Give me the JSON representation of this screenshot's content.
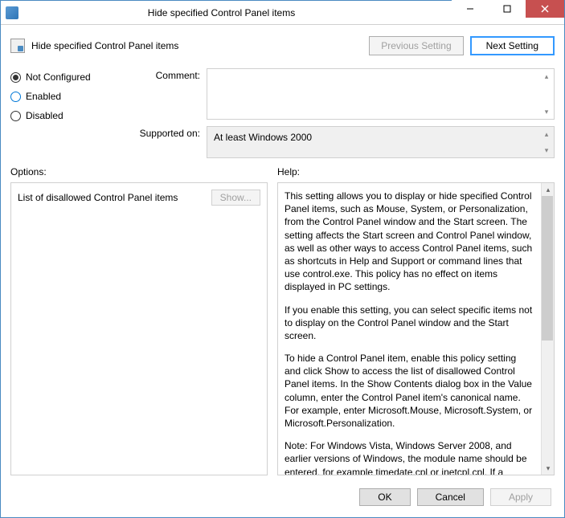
{
  "window": {
    "title": "Hide specified Control Panel items"
  },
  "header": {
    "title": "Hide specified Control Panel items",
    "prev_label": "Previous Setting",
    "next_label": "Next Setting"
  },
  "radios": {
    "not_configured": "Not Configured",
    "enabled": "Enabled",
    "disabled": "Disabled",
    "selected": "not_configured"
  },
  "fields": {
    "comment_label": "Comment:",
    "comment_value": "",
    "supported_label": "Supported on:",
    "supported_value": "At least Windows 2000"
  },
  "panels": {
    "options_label": "Options:",
    "help_label": "Help:"
  },
  "options": {
    "list_label": "List of disallowed Control Panel items",
    "show_label": "Show..."
  },
  "help": {
    "p1": "This setting allows you to display or hide specified Control Panel items, such as Mouse, System, or Personalization, from the Control Panel window and the Start screen. The setting affects the Start screen and Control Panel window, as well as other ways to access Control Panel items, such as shortcuts in Help and Support or command lines that use control.exe. This policy has no effect on items displayed in PC settings.",
    "p2": "If you enable this setting, you can select specific items not to display on the Control Panel window and the Start screen.",
    "p3": "To hide a Control Panel item, enable this policy setting and click Show to access the list of disallowed Control Panel items. In the Show Contents dialog box in the Value column, enter the Control Panel item's canonical name. For example, enter Microsoft.Mouse, Microsoft.System, or Microsoft.Personalization.",
    "p4": "Note: For Windows Vista, Windows Server 2008, and earlier versions of Windows, the module name should be entered, for example timedate.cpl or inetcpl.cpl. If a Control Panel item does"
  },
  "footer": {
    "ok": "OK",
    "cancel": "Cancel",
    "apply": "Apply"
  }
}
